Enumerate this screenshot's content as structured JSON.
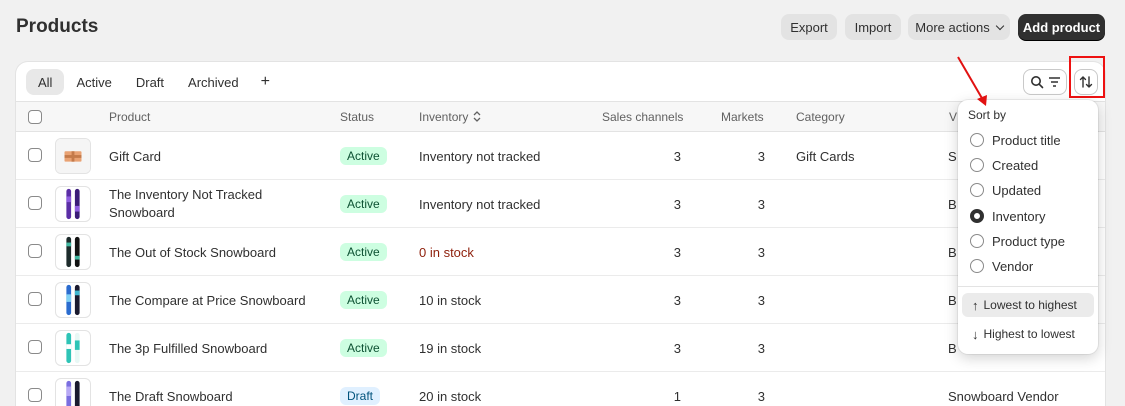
{
  "page": {
    "title": "Products"
  },
  "header_buttons": {
    "export": "Export",
    "import": "Import",
    "more_actions": "More actions",
    "add_product": "Add product"
  },
  "tabs": [
    "All",
    "Active",
    "Draft",
    "Archived",
    "+"
  ],
  "columns": {
    "product": "Product",
    "status": "Status",
    "inventory": "Inventory",
    "sales_channels": "Sales channels",
    "markets": "Markets",
    "category": "Category",
    "vendor": "V"
  },
  "rows": [
    {
      "name": "Gift Card",
      "name2": "",
      "status": "Active",
      "inventory": "Inventory not tracked",
      "sales_channels": "3",
      "markets": "3",
      "category": "Gift Cards",
      "vendor": "S"
    },
    {
      "name": "The Inventory Not Tracked",
      "name2": "Snowboard",
      "status": "Active",
      "inventory": "Inventory not tracked",
      "sales_channels": "3",
      "markets": "3",
      "category": "",
      "vendor": "B"
    },
    {
      "name": "The Out of Stock Snowboard",
      "name2": "",
      "status": "Active",
      "inventory": "0 in stock",
      "sales_channels": "3",
      "markets": "3",
      "category": "",
      "vendor": "B"
    },
    {
      "name": "The Compare at Price Snowboard",
      "name2": "",
      "status": "Active",
      "inventory": "10 in stock",
      "sales_channels": "3",
      "markets": "3",
      "category": "",
      "vendor": "B"
    },
    {
      "name": "The 3p Fulfilled Snowboard",
      "name2": "",
      "status": "Active",
      "inventory": "19 in stock",
      "sales_channels": "3",
      "markets": "3",
      "category": "",
      "vendor": "B"
    },
    {
      "name": "The Draft Snowboard",
      "name2": "",
      "status": "Draft",
      "inventory": "20 in stock",
      "sales_channels": "1",
      "markets": "3",
      "category": "",
      "vendor": "Snowboard Vendor"
    }
  ],
  "sort": {
    "title": "Sort by",
    "options": [
      "Product title",
      "Created",
      "Updated",
      "Inventory",
      "Product type",
      "Vendor"
    ],
    "selected": "Inventory",
    "lowest": "Lowest to highest",
    "highest": "Highest to lowest"
  },
  "colors": {
    "accent_dark": "#303030",
    "annotation_red": "#e11111",
    "active_badge": "#cdfee1",
    "draft_badge": "#e0f0ff"
  }
}
